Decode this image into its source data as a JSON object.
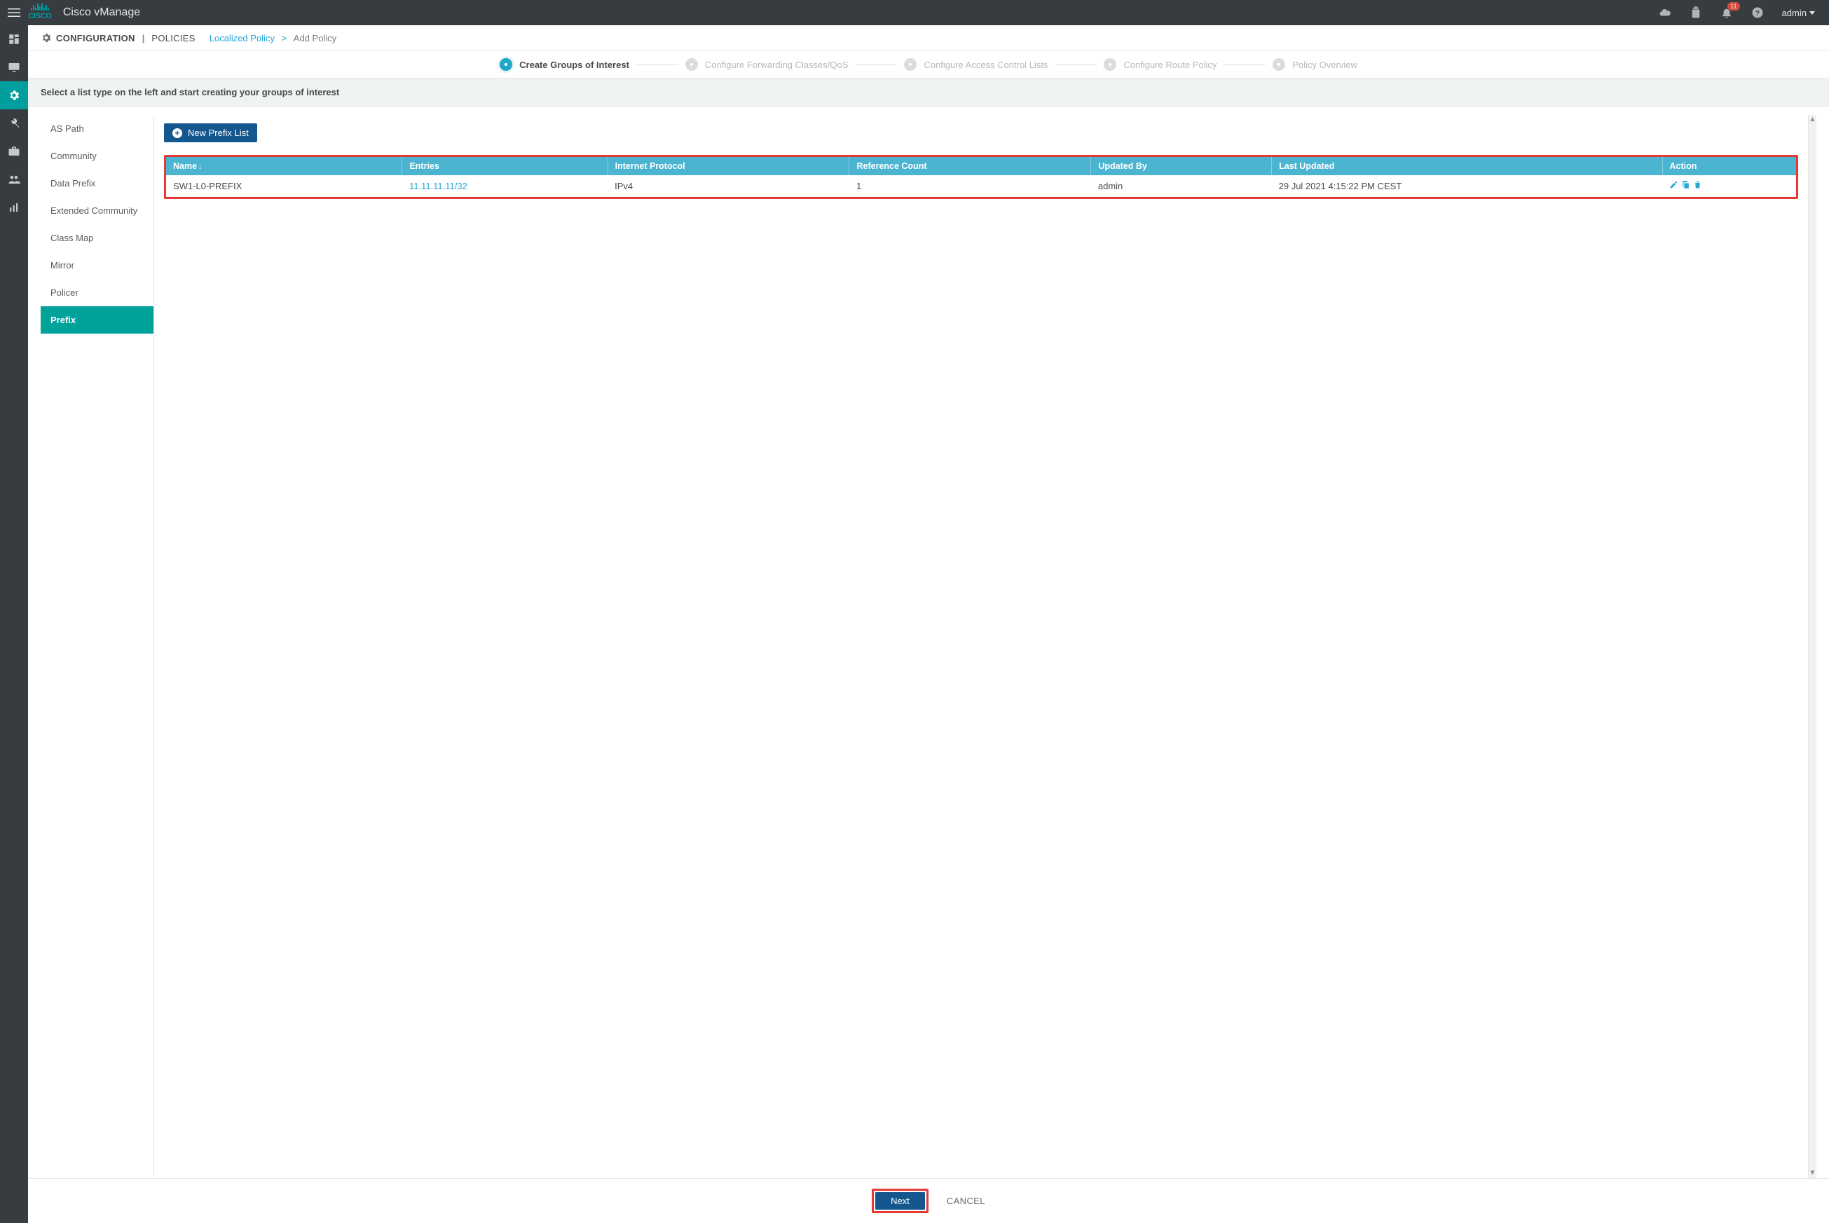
{
  "header": {
    "app_title": "Cisco vManage",
    "notification_count": "11",
    "user": "admin"
  },
  "breadcrumb": {
    "section": "CONFIGURATION",
    "subsection": "POLICIES",
    "link": "Localized Policy",
    "current": "Add Policy"
  },
  "steps": [
    "Create Groups of Interest",
    "Configure Forwarding Classes/QoS",
    "Configure Access Control Lists",
    "Configure Route Policy",
    "Policy Overview"
  ],
  "instruction": "Select a list type on the left and start creating your groups of interest",
  "list_types": [
    "AS Path",
    "Community",
    "Data Prefix",
    "Extended Community",
    "Class Map",
    "Mirror",
    "Policer",
    "Prefix"
  ],
  "active_list_type": "Prefix",
  "new_button_label": "New Prefix List",
  "table": {
    "headers": [
      "Name",
      "Entries",
      "Internet Protocol",
      "Reference Count",
      "Updated By",
      "Last Updated",
      "Action"
    ],
    "rows": [
      {
        "name": "SW1-L0-PREFIX",
        "entries": "11.11.11.11/32",
        "protocol": "IPv4",
        "ref_count": "1",
        "updated_by": "admin",
        "last_updated": "29 Jul 2021 4:15:22 PM CEST"
      }
    ]
  },
  "footer": {
    "next": "Next",
    "cancel": "CANCEL"
  }
}
